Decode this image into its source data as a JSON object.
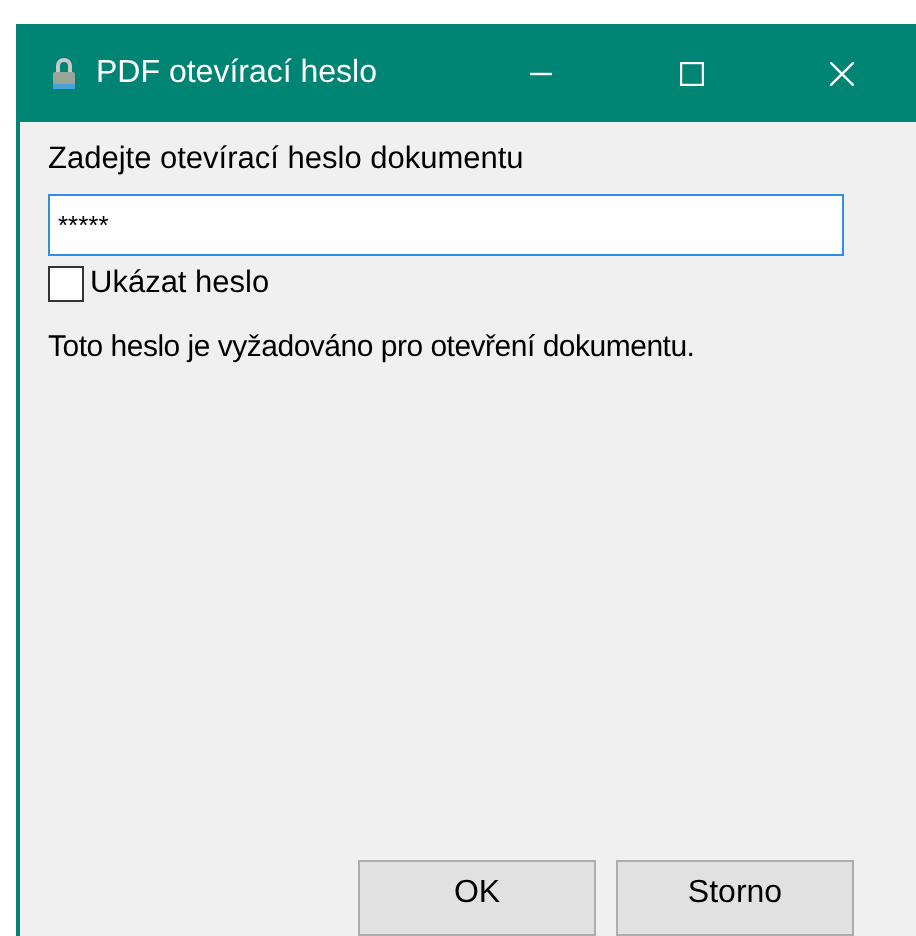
{
  "window": {
    "title": "PDF otevírací heslo"
  },
  "prompt": "Zadejte otevírací heslo dokumentu",
  "password_field": {
    "value": "*****",
    "focused": true
  },
  "show_password": {
    "label": "Ukázat heslo",
    "checked": false
  },
  "info": "Toto heslo je vyžadováno pro otevření dokumentu.",
  "buttons": [
    "OK",
    "Storno"
  ]
}
